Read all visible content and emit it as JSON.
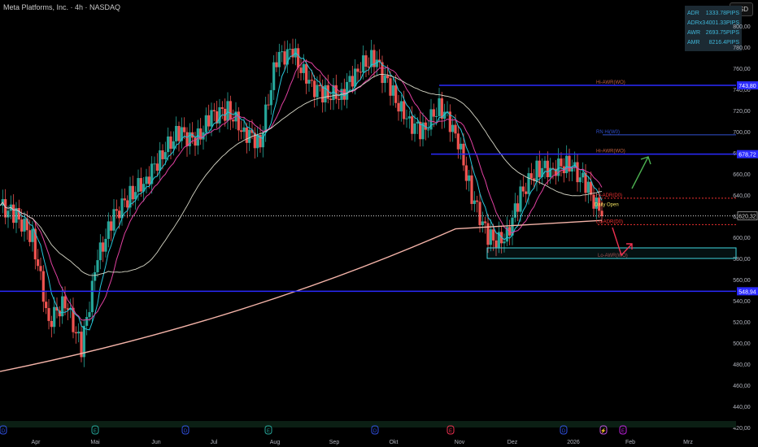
{
  "header": {
    "title": "Meta Platforms, Inc. · 4h · NASDAQ",
    "currency": "USD"
  },
  "stats": [
    {
      "label": "ADR",
      "value": "1333.78PIPS"
    },
    {
      "label": "ADRx3",
      "value": "4001.33PIPS"
    },
    {
      "label": "AWR",
      "value": "2693.75PIPS"
    },
    {
      "label": "AMR",
      "value": "8216.4PIPS"
    }
  ],
  "colors": {
    "bg": "#000000",
    "up": "#26a69a",
    "down": "#ef5350",
    "level": "#2a2aff",
    "cyan": "#40d8e0",
    "ma200": "#f4b3a8",
    "ma": "#d8d8c8"
  },
  "chart_data": {
    "type": "line",
    "title": "Meta Platforms, Inc. · 4h · NASDAQ",
    "ylim": [
      420,
      800
    ],
    "y_ticks": [
      "800,00",
      "780,00",
      "760,00",
      "740,00",
      "720,00",
      "700,00",
      "680,00",
      "660,00",
      "640,00",
      "620,00",
      "600,00",
      "580,00",
      "560,00",
      "540,00",
      "520,00",
      "500,00",
      "480,00",
      "460,00",
      "440,00",
      "420,00"
    ],
    "x_ticks": [
      "Apr",
      "Mai",
      "Jun",
      "Jul",
      "Aug",
      "Sep",
      "Okt",
      "Nov",
      "Dez",
      "2026",
      "Feb",
      "Mrz"
    ],
    "closes": [
      630,
      620,
      600,
      520,
      540,
      495,
      580,
      620,
      640,
      655,
      680,
      700,
      690,
      715,
      720,
      700,
      690,
      770,
      775,
      745,
      735,
      735,
      760,
      770,
      740,
      710,
      700,
      725,
      700,
      640,
      600,
      595,
      640,
      665,
      665,
      670,
      650,
      620
    ],
    "levels": [
      {
        "price": 743.8,
        "label": "Hi-AWR(WO)",
        "tag": "743,80",
        "color": "#2a2aff",
        "kind": "solid"
      },
      {
        "price": 697,
        "label": "RN Hi(W0)",
        "color": "#3050d0",
        "kind": "thin"
      },
      {
        "price": 678.72,
        "label": "Hi-AWR(WO)",
        "tag": "678,72",
        "color": "#2a2aff",
        "kind": "solid"
      },
      {
        "price": 637,
        "label": "Hi-ADR(D0)",
        "color": "#ef3030",
        "kind": "dashed"
      },
      {
        "price": 628,
        "label": "Daily Open",
        "color": "#f0e060",
        "kind": "text"
      },
      {
        "price": 612,
        "label": "Lo-ADR(D0)",
        "color": "#ef3030",
        "kind": "dashed"
      },
      {
        "price": 548.94,
        "label": "",
        "tag": "548,94",
        "color": "#2a2aff",
        "kind": "solid"
      }
    ],
    "zone": {
      "from": 580,
      "to": 590,
      "label": "Lo-AWR(WO)",
      "color": "#40d8e0"
    },
    "last_price": {
      "value": 620.32,
      "tag": "620,32"
    },
    "event_markers": [
      "D",
      "E",
      "D",
      "E",
      "D",
      "E",
      "D",
      "⚡",
      "E"
    ]
  }
}
